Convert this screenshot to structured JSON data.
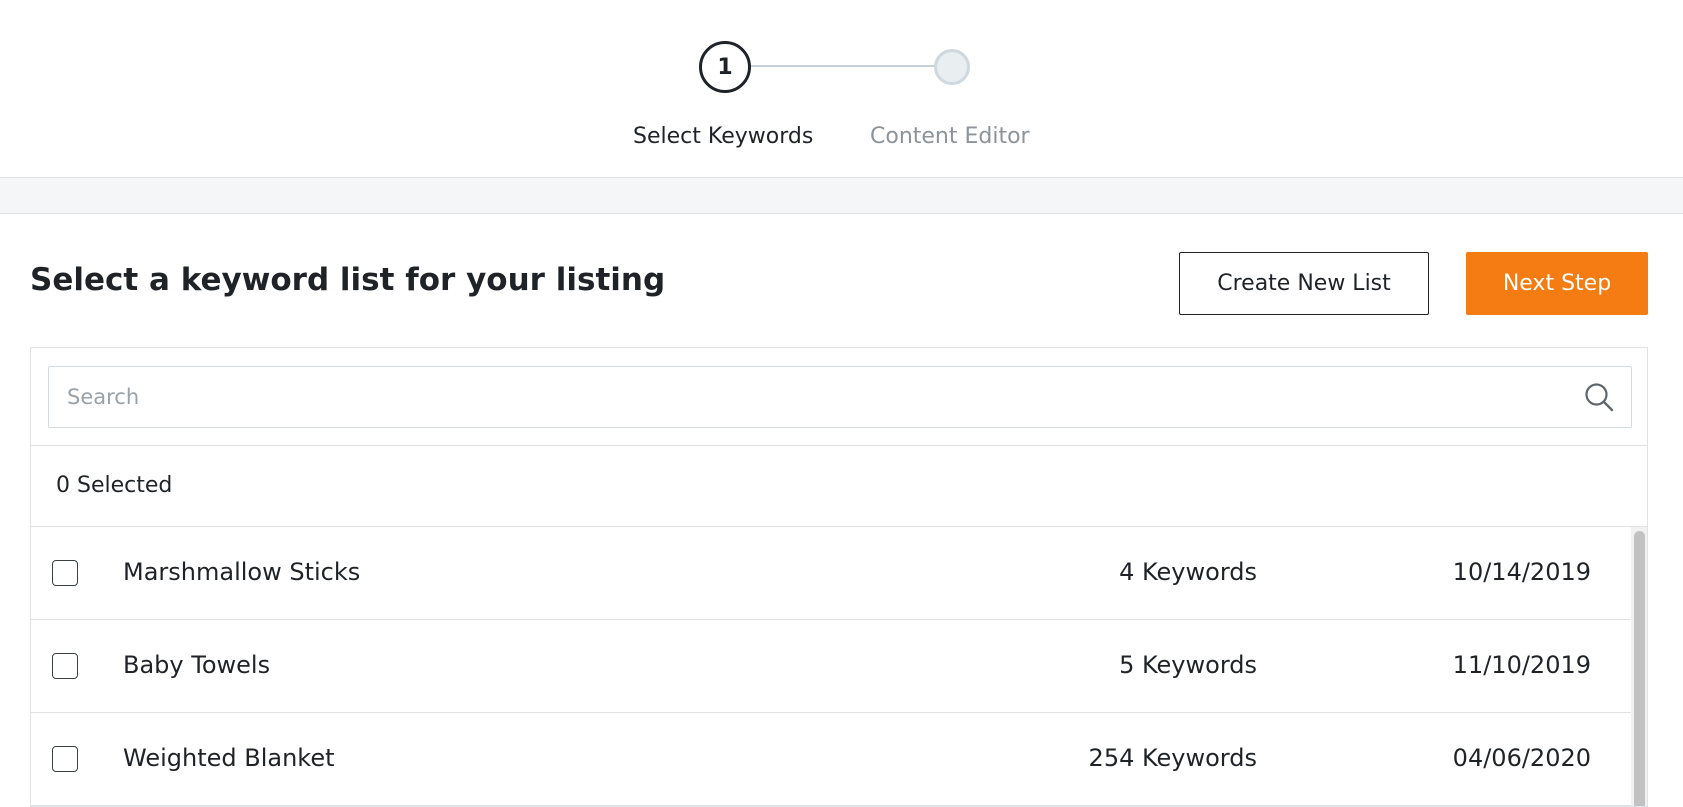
{
  "stepper": {
    "steps": [
      {
        "number": "1",
        "label": "Select Keywords",
        "state": "active"
      },
      {
        "number": "",
        "label": "Content Editor",
        "state": "inactive"
      }
    ]
  },
  "header": {
    "title": "Select a keyword list for your listing",
    "create_button": "Create New List",
    "next_button": "Next Step"
  },
  "search": {
    "placeholder": "Search",
    "value": "",
    "icon": "search-icon"
  },
  "selection": {
    "label": "0 Selected"
  },
  "lists": [
    {
      "name": "Marshmallow Sticks",
      "keywords": "4 Keywords",
      "date": "10/14/2019",
      "checked": false
    },
    {
      "name": "Baby Towels",
      "keywords": "5 Keywords",
      "date": "11/10/2019",
      "checked": false
    },
    {
      "name": "Weighted Blanket",
      "keywords": "254 Keywords",
      "date": "04/06/2020",
      "checked": false
    }
  ],
  "colors": {
    "accent": "#f47c12",
    "text": "#1f2328",
    "muted": "#8c9399",
    "border": "#dfe3e6"
  }
}
